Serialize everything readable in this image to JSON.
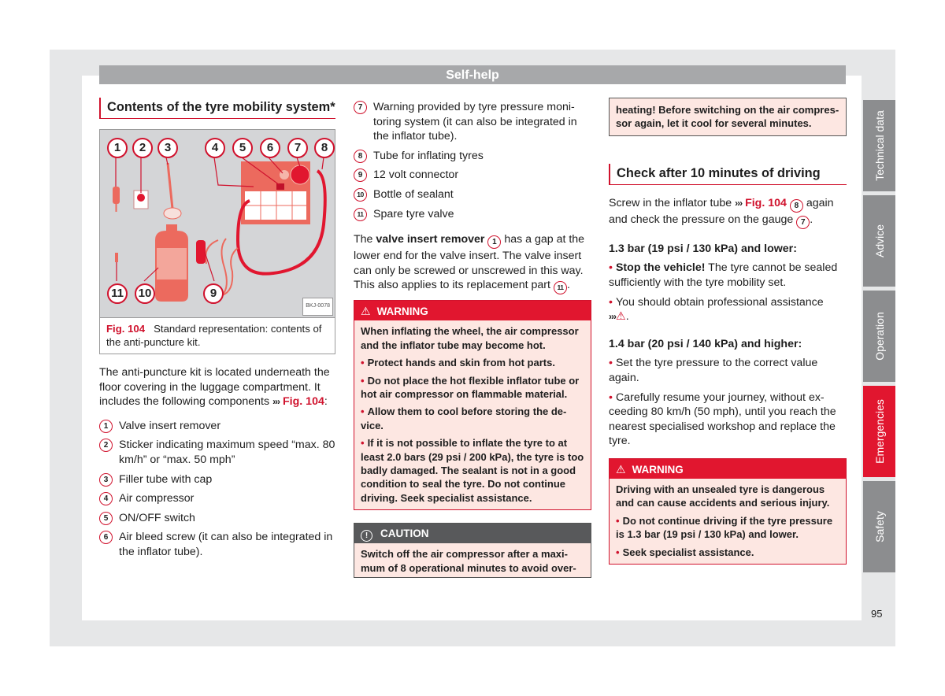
{
  "header": {
    "title": "Self-help"
  },
  "col1": {
    "heading": "Contents of the tyre mobility system*",
    "figure": {
      "callouts": [
        "1",
        "2",
        "3",
        "4",
        "5",
        "6",
        "7",
        "8",
        "9",
        "10",
        "11"
      ],
      "code": "BKJ-0078",
      "caption_label": "Fig. 104",
      "caption_text": "Standard representation: contents of the anti-puncture kit."
    },
    "intro": "The anti-puncture kit is located underneath the floor covering in the luggage compart­ment. It includes the following components",
    "intro_ref_arrows": "›››",
    "intro_ref": "Fig. 104",
    "intro_end": ":",
    "items": [
      {
        "num": "1",
        "text": "Valve insert remover"
      },
      {
        "num": "2",
        "text": "Sticker indicating maximum speed “max. 80 km/h” or “max. 50 mph”"
      },
      {
        "num": "3",
        "text": "Filler tube with cap"
      },
      {
        "num": "4",
        "text": "Air compressor"
      },
      {
        "num": "5",
        "text": "ON/OFF switch"
      },
      {
        "num": "6",
        "text": "Air bleed screw (it can also be integrated in the inflator tube)."
      }
    ]
  },
  "col2": {
    "items": [
      {
        "num": "7",
        "text": "Warning provided by tyre pressure moni­toring system (it can also be integrated in the inflator tube)."
      },
      {
        "num": "8",
        "text": "Tube for inflating tyres"
      },
      {
        "num": "9",
        "text": "12 volt connector"
      },
      {
        "num": "10",
        "text": "Bottle of sealant"
      },
      {
        "num": "11",
        "text": "Spare tyre valve"
      }
    ],
    "para_start": "The ",
    "para_bold": "valve insert remover",
    "para_num1": "1",
    "para_mid": " has a gap at the lower end for the valve insert. The valve in­sert can only be screwed or unscrewed in this way. This also applies to its replacement part",
    "para_num2": "11",
    "para_end": ".",
    "warning": {
      "label": "WARNING",
      "intro": "When inflating the wheel, the air compressor and the inflator tube may become hot.",
      "bullets": [
        "Protect hands and skin from hot parts.",
        "Do not place the hot flexible inflator tube or hot air compressor on flammable material.",
        "Allow them to cool before storing the de­vice.",
        "If it is not possible to inflate the tyre to at least 2.0 bars (29 psi / 200 kPa), the tyre is too badly damaged. The sealant is not in a good condition to seal the tyre. Do not con­tinue driving. Seek specialist assistance."
      ]
    },
    "caution": {
      "label": "CAUTION",
      "text": "Switch off the air compressor after a maxi­mum of 8 operational minutes to avoid over-"
    }
  },
  "col3": {
    "caution_cont": "heating! Before switching on the air compres­sor again, let it cool for several minutes.",
    "heading": "Check after 10 minutes of driving",
    "para_start": "Screw in the inflator tube",
    "para_arrows": "›››",
    "para_ref": "Fig. 104",
    "para_num1": "8",
    "para_mid": "again and check the pressure on the gauge",
    "para_num2": "7",
    "para_end": ".",
    "low": {
      "title": "1.3 bar (19 psi / 130 kPa) and lower:",
      "b1_bold": "Stop the vehicle!",
      "b1_text": " The tyre cannot be sealed sufficiently with the tyre mobility set.",
      "b2_text": "You should obtain professional assistance",
      "b2_arrows": "›››",
      "b2_end": "."
    },
    "high": {
      "title": "1.4 bar (20 psi / 140 kPa) and higher:",
      "bullets": [
        "Set the tyre pressure to the correct value again.",
        "Carefully resume your journey, without ex­ceeding 80 km/h (50 mph), until you reach the nearest specialised workshop and re­place the tyre."
      ]
    },
    "warning": {
      "label": "WARNING",
      "intro": "Driving with an unsealed tyre is dangerous and can cause accidents and serious injury.",
      "bullets": [
        "Do not continue driving if the tyre pressure is 1.3 bar (19 psi / 130 kPa) and lower.",
        "Seek specialist assistance."
      ]
    }
  },
  "side_tabs": [
    {
      "label": "Technical data",
      "active": false
    },
    {
      "label": "Advice",
      "active": false
    },
    {
      "label": "Operation",
      "active": false
    },
    {
      "label": "Emergencies",
      "active": true
    },
    {
      "label": "Safety",
      "active": false
    }
  ],
  "page_number": "95",
  "colors": {
    "accent_red": "#d0122d",
    "warning_red": "#e1162f",
    "caution_gray": "#58595b",
    "tab_gray": "#8c8d8f",
    "box_bg": "#fde7e2"
  }
}
